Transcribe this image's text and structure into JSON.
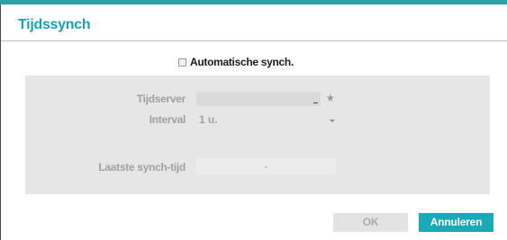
{
  "dialog": {
    "title": "Tijdssynch"
  },
  "auto_sync": {
    "label": "Automatische synch.",
    "checked": false
  },
  "panel": {
    "time_server": {
      "label": "Tijdserver",
      "value": "",
      "star_icon": "star-icon"
    },
    "interval": {
      "label": "Interval",
      "value": "1 u.",
      "icon": "chevron-down-icon"
    },
    "last_sync": {
      "label": "Laatste synch-tijd",
      "value": "-"
    }
  },
  "buttons": {
    "ok": "OK",
    "cancel": "Annuleren"
  },
  "colors": {
    "accent": "#16a3b7",
    "button_primary": "#1aa9b8",
    "panel_bg": "#e6e6e6"
  }
}
